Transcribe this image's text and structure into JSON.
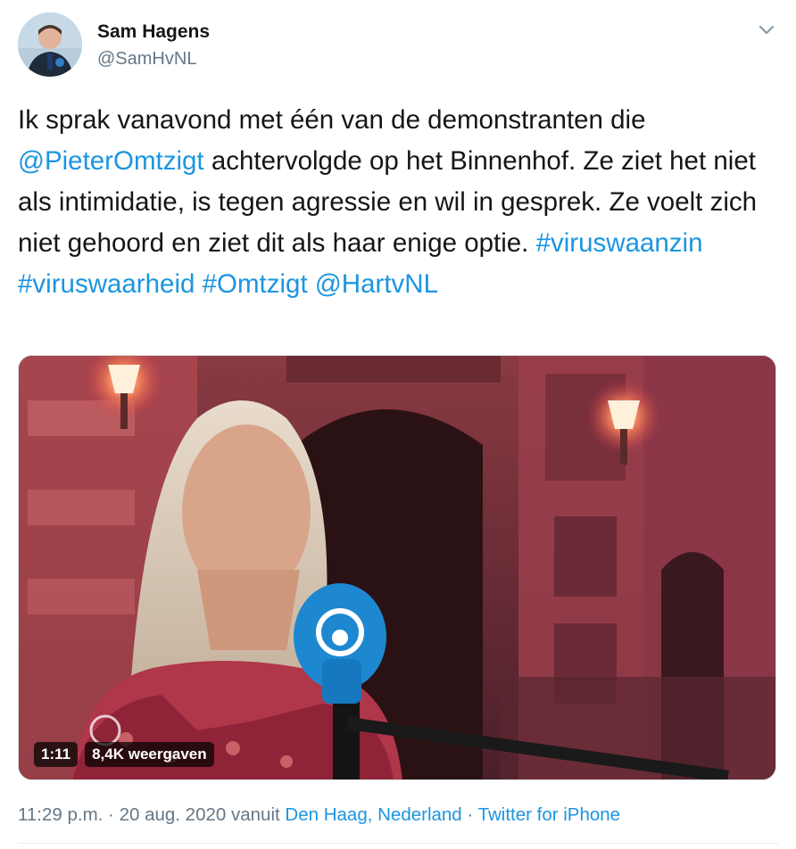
{
  "author": {
    "name": "Sam Hagens",
    "handle": "@SamHvNL"
  },
  "tweet": {
    "t1": "Ik sprak vanavond met één van de demonstranten die ",
    "mention1": "@PieterOmtzigt",
    "t2": " achtervolgde op het Binnenhof. Ze ziet het niet als intimidatie, is tegen agressie en wil in gesprek. Ze voelt zich niet gehoord en ziet dit als haar enige optie. ",
    "hashtag1": "#viruswaanzin",
    "hashtag2": "#viruswaarheid",
    "hashtag3": "#Omtzigt",
    "mention2": "@HartvNL"
  },
  "video": {
    "duration": "1:11",
    "views": "8,4K weergaven"
  },
  "meta": {
    "time": "11:29 p.m.",
    "date": "20 aug. 2020",
    "via": "vanuit",
    "location": "Den Haag, Nederland",
    "source": "Twitter for iPhone",
    "sep": "·"
  },
  "icons": {
    "caret": "chevron-down-icon"
  },
  "colors": {
    "link": "#1b95e0",
    "secondary": "#657786",
    "text": "#14171a"
  }
}
